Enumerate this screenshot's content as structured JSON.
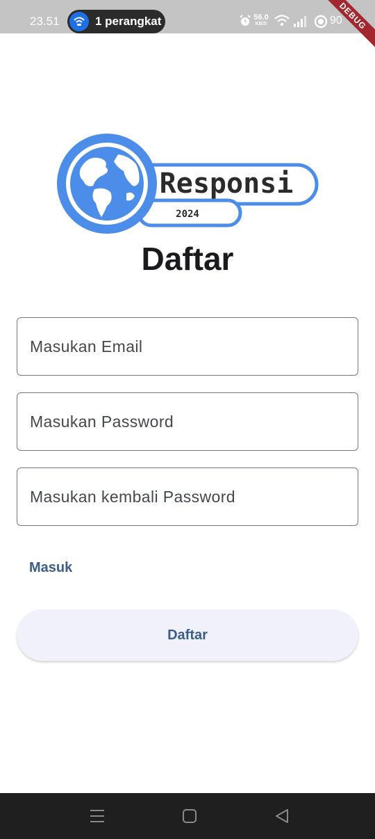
{
  "status_bar": {
    "time": "23.51",
    "hotspot_text": "1 perangkat",
    "net_speed_value": "56.0",
    "net_speed_unit": "KB/S",
    "battery": "90"
  },
  "debug_banner": "DEBUG",
  "logo": {
    "brand": "Responsi",
    "year": "2024",
    "color": "#4b8de8"
  },
  "page": {
    "title": "Daftar"
  },
  "form": {
    "email_placeholder": "Masukan Email",
    "password_placeholder": "Masukan Password",
    "confirm_password_placeholder": "Masukan kembali Password",
    "login_link": "Masuk",
    "submit_label": "Daftar"
  },
  "colors": {
    "accent": "#3b5d88",
    "title": "#1b1b1f",
    "button_bg": "#f0f1fa",
    "status_bar": "#c4c4c4",
    "nav_bar": "#1f1f1f"
  }
}
